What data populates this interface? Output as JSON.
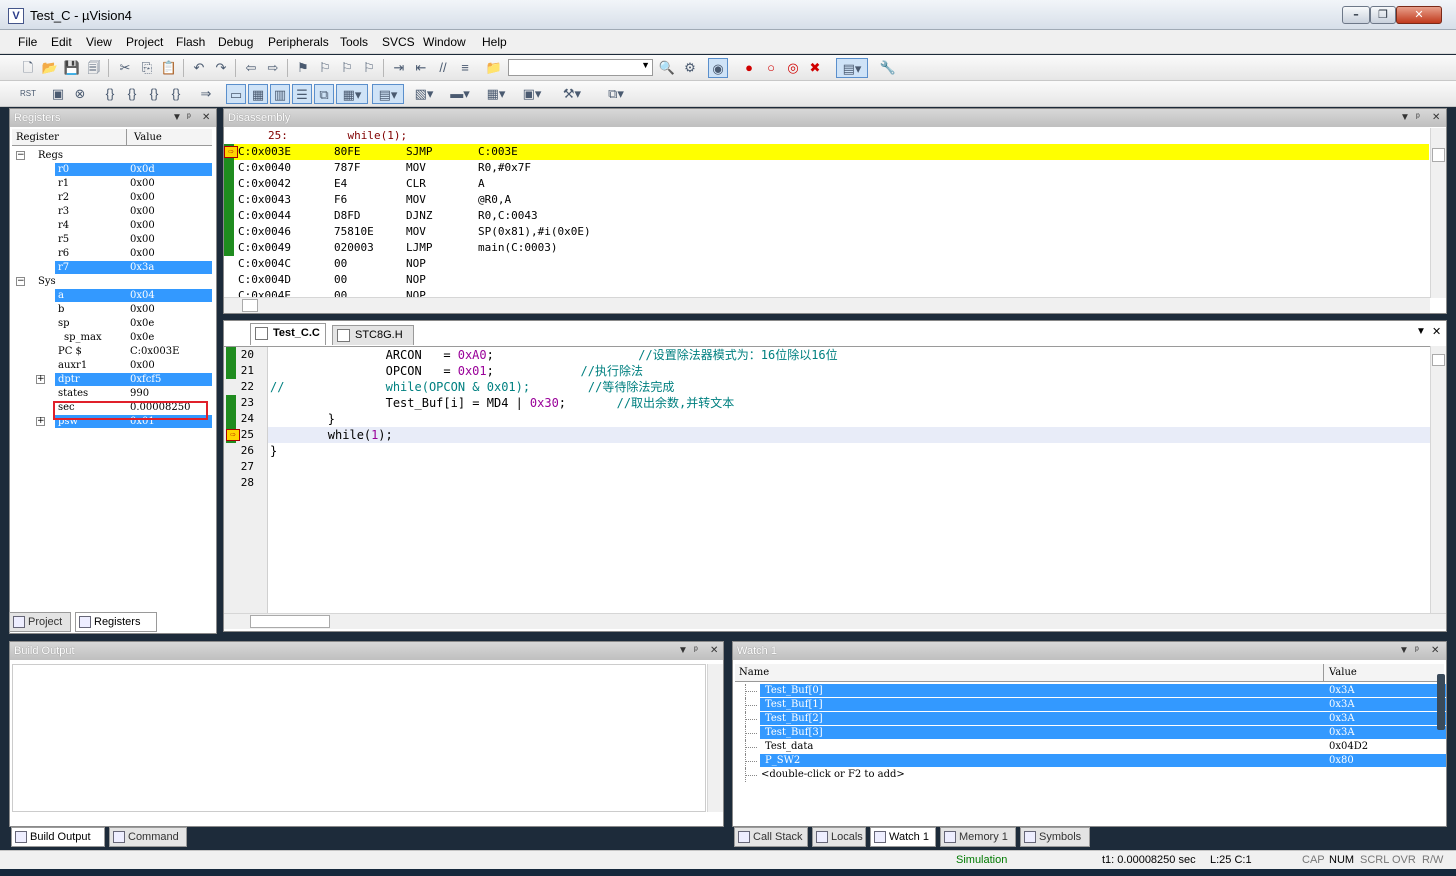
{
  "window": {
    "title": "Test_C - µVision4",
    "icon": "uvision-app-icon"
  },
  "menu": [
    "File",
    "Edit",
    "View",
    "Project",
    "Flash",
    "Debug",
    "Peripherals",
    "Tools",
    "SVCS",
    "Window",
    "Help"
  ],
  "registers": {
    "title": "Registers",
    "col_register": "Register",
    "col_value": "Value",
    "groups": {
      "regs": "Regs",
      "sys": "Sys"
    },
    "regs": [
      {
        "name": "r0",
        "value": "0x0d",
        "selected": true
      },
      {
        "name": "r1",
        "value": "0x00",
        "selected": false
      },
      {
        "name": "r2",
        "value": "0x00",
        "selected": false
      },
      {
        "name": "r3",
        "value": "0x00",
        "selected": false
      },
      {
        "name": "r4",
        "value": "0x00",
        "selected": false
      },
      {
        "name": "r5",
        "value": "0x00",
        "selected": false
      },
      {
        "name": "r6",
        "value": "0x00",
        "selected": false
      },
      {
        "name": "r7",
        "value": "0x3a",
        "selected": true
      }
    ],
    "sys": [
      {
        "name": "a",
        "value": "0x04",
        "selected": true
      },
      {
        "name": "b",
        "value": "0x00",
        "selected": false
      },
      {
        "name": "sp",
        "value": "0x0e",
        "selected": false
      },
      {
        "name": "sp_max",
        "value": "0x0e",
        "selected": false
      },
      {
        "name": "PC  $",
        "value": "C:0x003E",
        "selected": false
      },
      {
        "name": "auxr1",
        "value": "0x00",
        "selected": false
      },
      {
        "name": "dptr",
        "value": "0xfcf5",
        "selected": true
      },
      {
        "name": "states",
        "value": "990",
        "selected": false
      },
      {
        "name": "sec",
        "value": "0.00008250",
        "selected": false
      },
      {
        "name": "psw",
        "value": "0x01",
        "selected": true
      }
    ],
    "tabs": [
      "Project",
      "Registers"
    ]
  },
  "disassembly": {
    "title": "Disassembly",
    "source_line": "25:         while(1);",
    "rows": [
      {
        "addr": "C:0x003E",
        "code": "80FE",
        "mnem": "SJMP",
        "ops": "C:003E",
        "current": true,
        "covered": true
      },
      {
        "addr": "C:0x0040",
        "code": "787F",
        "mnem": "MOV",
        "ops": "R0,#0x7F",
        "current": false,
        "covered": true
      },
      {
        "addr": "C:0x0042",
        "code": "E4",
        "mnem": "CLR",
        "ops": "A",
        "current": false,
        "covered": true
      },
      {
        "addr": "C:0x0043",
        "code": "F6",
        "mnem": "MOV",
        "ops": "@R0,A",
        "current": false,
        "covered": true
      },
      {
        "addr": "C:0x0044",
        "code": "D8FD",
        "mnem": "DJNZ",
        "ops": "R0,C:0043",
        "current": false,
        "covered": true
      },
      {
        "addr": "C:0x0046",
        "code": "75810E",
        "mnem": "MOV",
        "ops": "SP(0x81),#i(0x0E)",
        "current": false,
        "covered": true
      },
      {
        "addr": "C:0x0049",
        "code": "020003",
        "mnem": "LJMP",
        "ops": "main(C:0003)",
        "current": false,
        "covered": true
      },
      {
        "addr": "C:0x004C",
        "code": "00",
        "mnem": "NOP",
        "ops": "",
        "current": false,
        "covered": false
      },
      {
        "addr": "C:0x004D",
        "code": "00",
        "mnem": "NOP",
        "ops": "",
        "current": false,
        "covered": false
      },
      {
        "addr": "C:0x004E",
        "code": "00",
        "mnem": "NOP",
        "ops": "",
        "current": false,
        "covered": false
      }
    ]
  },
  "editor": {
    "tabs": [
      {
        "label": "Test_C.C",
        "active": true
      },
      {
        "label": "STC8G.H",
        "active": false
      }
    ],
    "lines": [
      {
        "n": "20",
        "covered": true,
        "current": false,
        "segs": [
          {
            "t": "                ARCON   = ",
            "k": "kw"
          },
          {
            "t": "0xA0",
            "k": "num"
          },
          {
            "t": ";",
            "k": "kw"
          },
          {
            "t": "                    //设置除法器模式为：16位除以16位",
            "k": "cmt"
          }
        ]
      },
      {
        "n": "21",
        "covered": true,
        "current": false,
        "segs": [
          {
            "t": "                OPCON   = ",
            "k": "kw"
          },
          {
            "t": "0x01",
            "k": "num"
          },
          {
            "t": ";",
            "k": "kw"
          },
          {
            "t": "            //执行除法",
            "k": "cmt"
          }
        ]
      },
      {
        "n": "22",
        "covered": false,
        "current": false,
        "segs": [
          {
            "t": "//              while(OPCON & 0x01);        //等待除法完成",
            "k": "cmt"
          }
        ]
      },
      {
        "n": "23",
        "covered": true,
        "current": false,
        "segs": [
          {
            "t": "                Test_Buf[i] = MD4 | ",
            "k": "kw"
          },
          {
            "t": "0x30",
            "k": "num"
          },
          {
            "t": ";",
            "k": "kw"
          },
          {
            "t": "       //取出余数,并转文本",
            "k": "cmt"
          }
        ]
      },
      {
        "n": "24",
        "covered": true,
        "current": false,
        "segs": [
          {
            "t": "        }",
            "k": "kw"
          }
        ]
      },
      {
        "n": "25",
        "covered": true,
        "current": true,
        "segs": [
          {
            "t": "        while(",
            "k": "kw"
          },
          {
            "t": "1",
            "k": "num"
          },
          {
            "t": ");",
            "k": "kw"
          }
        ]
      },
      {
        "n": "26",
        "covered": false,
        "current": false,
        "segs": [
          {
            "t": "}",
            "k": "kw"
          }
        ]
      },
      {
        "n": "27",
        "covered": false,
        "current": false,
        "segs": []
      },
      {
        "n": "28",
        "covered": false,
        "current": false,
        "segs": []
      }
    ]
  },
  "build_output": {
    "title": "Build Output",
    "tabs": [
      "Build Output",
      "Command"
    ]
  },
  "watch": {
    "title": "Watch 1",
    "col_name": "Name",
    "col_value": "Value",
    "rows": [
      {
        "name": "Test_Buf[0]",
        "value": "0x3A",
        "selected": true
      },
      {
        "name": "Test_Buf[1]",
        "value": "0x3A",
        "selected": true
      },
      {
        "name": "Test_Buf[2]",
        "value": "0x3A",
        "selected": true
      },
      {
        "name": "Test_Buf[3]",
        "value": "0x3A",
        "selected": true
      },
      {
        "name": "Test_data",
        "value": "0x04D2",
        "selected": false
      },
      {
        "name": "P_SW2",
        "value": "0x80",
        "selected": true
      }
    ],
    "add_hint": "<double-click or F2 to add>",
    "tabs": [
      "Call Stack",
      "Locals",
      "Watch 1",
      "Memory 1",
      "Symbols"
    ]
  },
  "status": {
    "mode": "Simulation",
    "time": "t1: 0.00008250 sec",
    "pos": "L:25 C:1",
    "keys": [
      "CAP",
      "NUM",
      "SCRL",
      "OVR",
      "R/W"
    ]
  },
  "colors": {
    "accent_select": "#3399ff",
    "current_line": "#ffff00",
    "coverage": "#1f8c1f",
    "highlight_box": "#e0202a",
    "comment": "#008080",
    "number": "#990099"
  }
}
